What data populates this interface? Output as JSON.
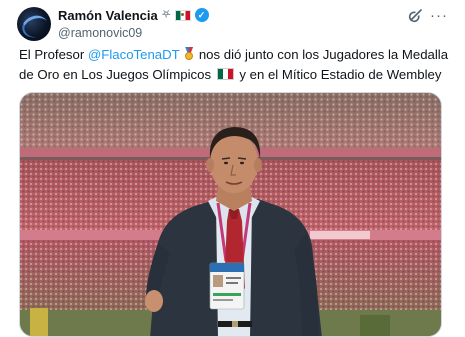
{
  "author": {
    "name": "Ramón Valencia",
    "badge_symbol": "⛧",
    "handle": "@ramonovic09",
    "verified_symbol": "✓"
  },
  "actions": {
    "grok_icon": "grok-icon",
    "more_symbol": "···"
  },
  "tweet": {
    "text_before": "El Profesor ",
    "mention": "@FlacoTenaDT",
    "text_middle": " nos dió junto con los Jugadores la Medalla de Oro en Los Juegos Olímpicos ",
    "text_after": " y en el Mítico Estadio de Wembley"
  },
  "colors": {
    "link": "#1d9bf0",
    "verified": "#1d9bf0",
    "text": "#0f1419",
    "muted": "#536471"
  },
  "media": {
    "description_icon": "photo",
    "subject": "man-in-suit-photo"
  }
}
